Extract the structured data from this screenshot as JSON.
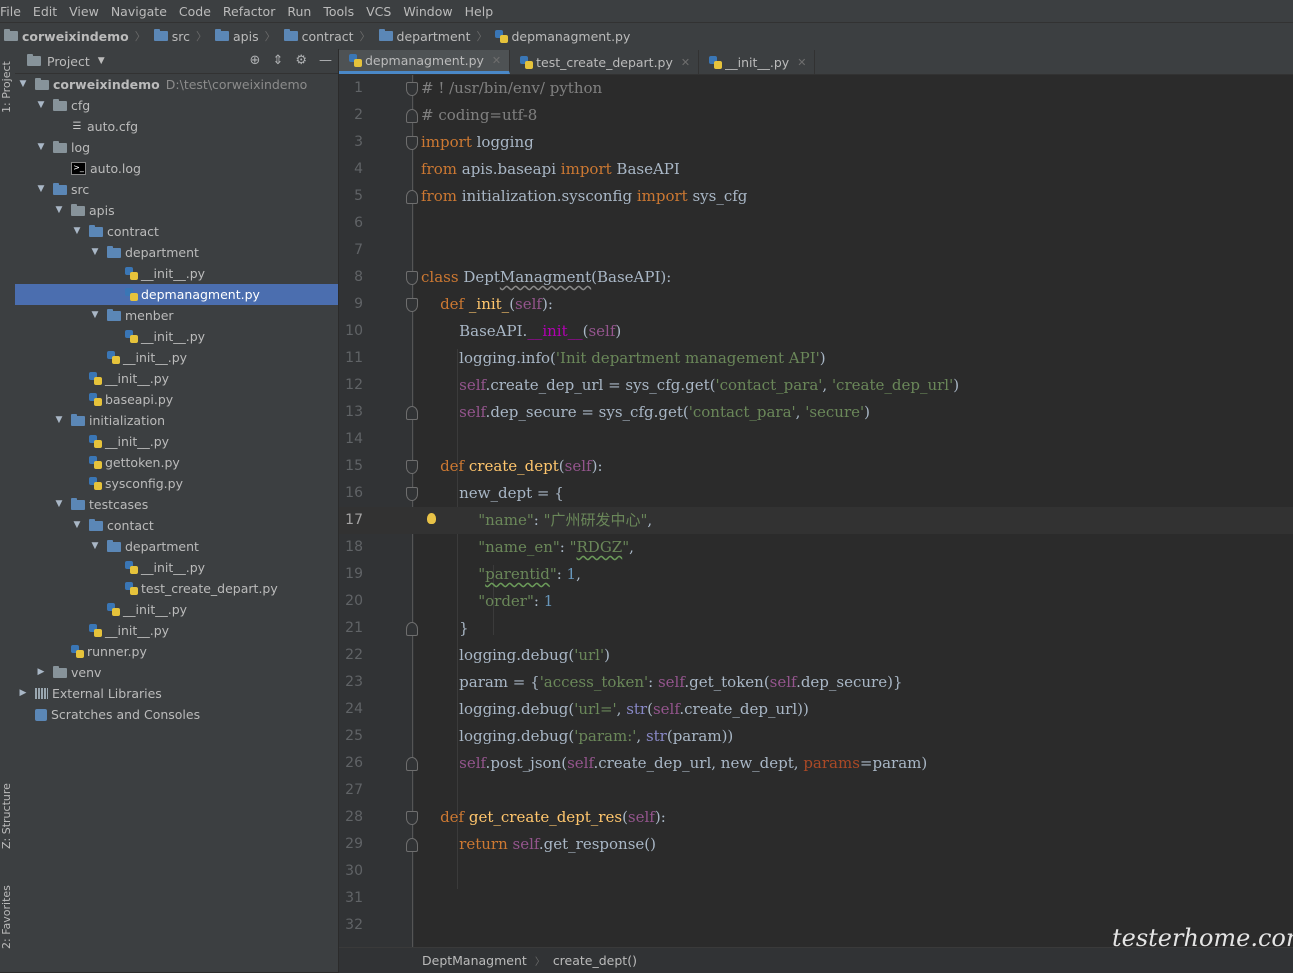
{
  "menu": [
    "File",
    "Edit",
    "View",
    "Navigate",
    "Code",
    "Refactor",
    "Run",
    "Tools",
    "VCS",
    "Window",
    "Help"
  ],
  "breadcrumbs": [
    "corweixindemo",
    "src",
    "apis",
    "contract",
    "department",
    "depmanagment.py"
  ],
  "left_toolbar": {
    "project": "1: Project",
    "structure": "Z: Structure",
    "favorites": "2: Favorites"
  },
  "project_panel": {
    "title": "Project"
  },
  "tree": [
    {
      "label": "corweixindemo",
      "path": "D:\\test\\corweixindemo",
      "depth": 0,
      "type": "folder",
      "arrow": "open",
      "bold": true
    },
    {
      "label": "cfg",
      "depth": 1,
      "type": "folder",
      "arrow": "open"
    },
    {
      "label": "auto.cfg",
      "depth": 2,
      "type": "cfg"
    },
    {
      "label": "log",
      "depth": 1,
      "type": "folder",
      "arrow": "open"
    },
    {
      "label": "auto.log",
      "depth": 2,
      "type": "log"
    },
    {
      "label": "src",
      "depth": 1,
      "type": "folder-blue",
      "arrow": "open"
    },
    {
      "label": "apis",
      "depth": 2,
      "type": "folder",
      "arrow": "open"
    },
    {
      "label": "contract",
      "depth": 3,
      "type": "folder-blue",
      "arrow": "open"
    },
    {
      "label": "department",
      "depth": 4,
      "type": "folder-blue",
      "arrow": "open"
    },
    {
      "label": "__init__.py",
      "depth": 5,
      "type": "py"
    },
    {
      "label": "depmanagment.py",
      "depth": 5,
      "type": "py",
      "selected": true
    },
    {
      "label": "menber",
      "depth": 4,
      "type": "folder-blue",
      "arrow": "open"
    },
    {
      "label": "__init__.py",
      "depth": 5,
      "type": "py"
    },
    {
      "label": "__init__.py",
      "depth": 4,
      "type": "py"
    },
    {
      "label": "__init__.py",
      "depth": 3,
      "type": "py"
    },
    {
      "label": "baseapi.py",
      "depth": 3,
      "type": "py"
    },
    {
      "label": "initialization",
      "depth": 2,
      "type": "folder-blue",
      "arrow": "open"
    },
    {
      "label": "__init__.py",
      "depth": 3,
      "type": "py"
    },
    {
      "label": "gettoken.py",
      "depth": 3,
      "type": "py"
    },
    {
      "label": "sysconfig.py",
      "depth": 3,
      "type": "py"
    },
    {
      "label": "testcases",
      "depth": 2,
      "type": "folder-blue",
      "arrow": "open"
    },
    {
      "label": "contact",
      "depth": 3,
      "type": "folder-blue",
      "arrow": "open"
    },
    {
      "label": "department",
      "depth": 4,
      "type": "folder-blue",
      "arrow": "open"
    },
    {
      "label": "__init__.py",
      "depth": 5,
      "type": "py"
    },
    {
      "label": "test_create_depart.py",
      "depth": 5,
      "type": "py"
    },
    {
      "label": "__init__.py",
      "depth": 4,
      "type": "py"
    },
    {
      "label": "__init__.py",
      "depth": 3,
      "type": "py"
    },
    {
      "label": "runner.py",
      "depth": 2,
      "type": "py"
    },
    {
      "label": "venv",
      "depth": 1,
      "type": "folder",
      "arrow": "closed"
    },
    {
      "label": "External Libraries",
      "depth": 0,
      "type": "lib",
      "arrow": "closed"
    },
    {
      "label": "Scratches and Consoles",
      "depth": 0,
      "type": "scratch"
    }
  ],
  "tabs": [
    {
      "label": "depmanagment.py",
      "active": true
    },
    {
      "label": "test_create_depart.py",
      "active": false
    },
    {
      "label": "__init__.py",
      "active": false
    }
  ],
  "code_lines": [
    {
      "n": "1",
      "html": "<span class=\"c\"># ! /usr/bin/env/ python</span>",
      "fold": "start"
    },
    {
      "n": "2",
      "html": "<span class=\"c\"># coding=utf-8</span>",
      "fold": "end"
    },
    {
      "n": "3",
      "html": "<span class=\"k\">import</span> logging",
      "fold": "start"
    },
    {
      "n": "4",
      "html": "<span class=\"k\">from</span> apis.baseapi <span class=\"k\">import</span> BaseAPI"
    },
    {
      "n": "5",
      "html": "<span class=\"k\">from</span> initialization.sysconfig <span class=\"k\">import</span> sys_cfg",
      "fold": "end"
    },
    {
      "n": "6",
      "html": ""
    },
    {
      "n": "7",
      "html": ""
    },
    {
      "n": "8",
      "html": "<span class=\"k\">class</span> Dept<span class=\"ulg\">Managment</span>(BaseAPI):",
      "fold": "start"
    },
    {
      "n": "9",
      "html": "    <span class=\"k\">def</span> <span class=\"fn\">_init_</span>(<span class=\"self\">self</span>):",
      "fold": "start"
    },
    {
      "n": "10",
      "html": "        BaseAPI.<span class=\"mg\">__init__</span>(<span class=\"self\">self</span>)"
    },
    {
      "n": "11",
      "html": "        logging.info(<span class=\"s\">'Init department management API'</span>)"
    },
    {
      "n": "12",
      "html": "        <span class=\"self\">self</span>.create_dep_url = sys_cfg.get(<span class=\"s\">'contact_para'</span>, <span class=\"s\">'create_dep_url'</span>)"
    },
    {
      "n": "13",
      "html": "        <span class=\"self\">self</span>.dep_secure = sys_cfg.get(<span class=\"s\">'contact_para'</span>, <span class=\"s\">'secure'</span>)",
      "fold": "end"
    },
    {
      "n": "14",
      "html": ""
    },
    {
      "n": "15",
      "html": "    <span class=\"k\">def</span> <span class=\"fn\">create_dept</span>(<span class=\"self\">self</span>):",
      "fold": "start"
    },
    {
      "n": "16",
      "html": "        new_dept = {",
      "fold": "start"
    },
    {
      "n": "17",
      "html": "            <span class=\"s\">\"name\"</span>: <span class=\"s\">\"广州研发中心\"</span>,",
      "current": true,
      "bulb": true
    },
    {
      "n": "18",
      "html": "            <span class=\"s\">\"name_en\"</span>: <span class=\"s\">\"<span class=\"ul\">RDGZ</span>\"</span>,"
    },
    {
      "n": "19",
      "html": "            <span class=\"s\">\"<span class=\"ul\">parentid</span>\"</span>: <span class=\"n\">1</span>,"
    },
    {
      "n": "20",
      "html": "            <span class=\"s\">\"order\"</span>: <span class=\"n\">1</span>"
    },
    {
      "n": "21",
      "html": "        }",
      "fold": "end"
    },
    {
      "n": "22",
      "html": "        logging.debug(<span class=\"s\">'url'</span>)"
    },
    {
      "n": "23",
      "html": "        param = {<span class=\"s\">'access_token'</span>: <span class=\"self\">self</span>.get_token(<span class=\"self\">self</span>.dep_secure)}"
    },
    {
      "n": "24",
      "html": "        logging.debug(<span class=\"s\">'url='</span>, <span class=\"bi\">str</span>(<span class=\"self\">self</span>.create_dep_url))"
    },
    {
      "n": "25",
      "html": "        logging.debug(<span class=\"s\">'param:'</span>, <span class=\"bi\">str</span>(param))"
    },
    {
      "n": "26",
      "html": "        <span class=\"self\">self</span>.post_json(<span class=\"self\">self</span>.create_dep_url, new_dept, <span class=\"pm\">params</span>=param)",
      "fold": "end"
    },
    {
      "n": "27",
      "html": ""
    },
    {
      "n": "28",
      "html": "    <span class=\"k\">def</span> <span class=\"fn\">get_create_dept_res</span>(<span class=\"self\">self</span>):",
      "fold": "start"
    },
    {
      "n": "29",
      "html": "        <span class=\"k\">return</span> <span class=\"self\">self</span>.get_response()",
      "fold": "end"
    },
    {
      "n": "30",
      "html": ""
    },
    {
      "n": "31",
      "html": ""
    },
    {
      "n": "32",
      "html": ""
    }
  ],
  "status_breadcrumbs": [
    "DeptManagment",
    "create_dept()"
  ],
  "watermark": "testerhome.com"
}
